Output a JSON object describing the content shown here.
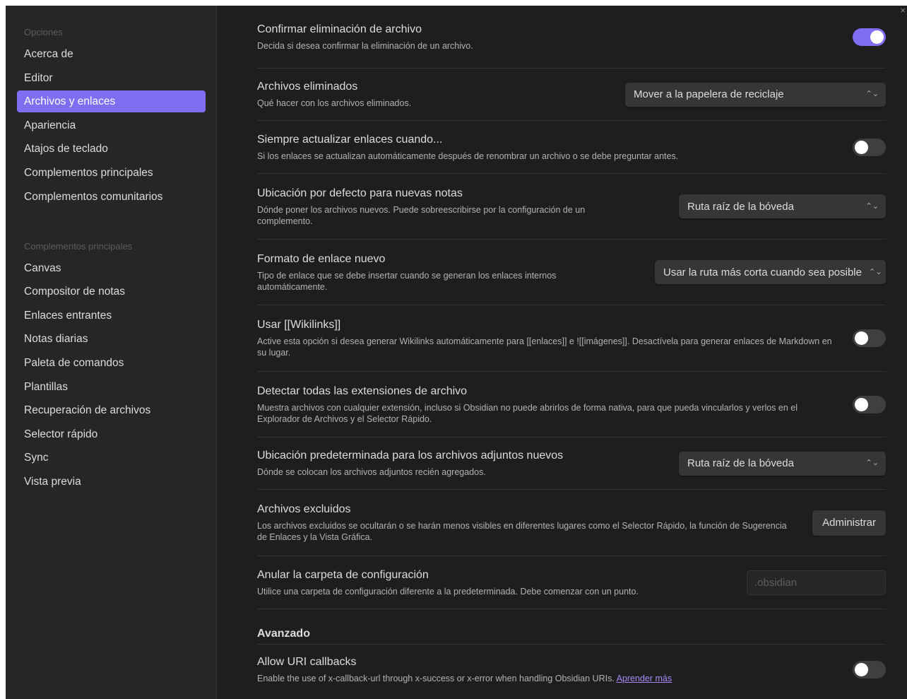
{
  "sidebar": {
    "heading_options": "Opciones",
    "options": [
      "Acerca de",
      "Editor",
      "Archivos y enlaces",
      "Apariencia",
      "Atajos de teclado",
      "Complementos principales",
      "Complementos comunitarios"
    ],
    "heading_plugins": "Complementos principales",
    "plugins": [
      "Canvas",
      "Compositor de notas",
      "Enlaces entrantes",
      "Notas diarias",
      "Paleta de comandos",
      "Plantillas",
      "Recuperación de archivos",
      "Selector rápido",
      "Sync",
      "Vista previa"
    ]
  },
  "settings": {
    "confirm_delete": {
      "name": "Confirmar eliminación de archivo",
      "desc": "Decida si desea confirmar la eliminación de un archivo.",
      "enabled": true
    },
    "deleted_files": {
      "name": "Archivos eliminados",
      "desc": "Qué hacer con los archivos eliminados.",
      "value": "Mover a la papelera de reciclaje"
    },
    "always_update_links": {
      "name": "Siempre actualizar enlaces cuando...",
      "desc": "Si los enlaces se actualizan automáticamente después de renombrar un archivo o se debe preguntar antes.",
      "enabled": false
    },
    "new_note_location": {
      "name": "Ubicación por defecto para nuevas notas",
      "desc": "Dónde poner los archivos nuevos. Puede sobreescribirse por la configuración de un complemento.",
      "value": "Ruta raíz de la bóveda"
    },
    "new_link_format": {
      "name": "Formato de enlace nuevo",
      "desc": "Tipo de enlace que se debe insertar cuando se generan los enlaces internos automáticamente.",
      "value": "Usar la ruta más corta cuando sea posible"
    },
    "wikilinks": {
      "name": "Usar [[Wikilinks]]",
      "desc": "Active esta opción si desea generar Wikilinks automáticamente para [[enlaces]] e ![[imágenes]]. Desactívela para generar enlaces de Markdown en su lugar.",
      "enabled": false
    },
    "detect_extensions": {
      "name": "Detectar todas las extensiones de archivo",
      "desc": "Muestra archivos con cualquier extensión, incluso si Obsidian no puede abrirlos de forma nativa, para que pueda vincularlos y verlos en el Explorador de Archivos y el Selector Rápido.",
      "enabled": false
    },
    "attachment_location": {
      "name": "Ubicación predeterminada para los archivos adjuntos nuevos",
      "desc": "Dónde se colocan los archivos adjuntos recién agregados.",
      "value": "Ruta raíz de la bóveda"
    },
    "excluded_files": {
      "name": "Archivos excluidos",
      "desc": "Los archivos excluidos se ocultarán o se harán menos visibles en diferentes lugares como el Selector Rápido, la función de Sugerencia de Enlaces y la Vista Gráfica.",
      "button": "Administrar"
    },
    "config_folder": {
      "name": "Anular la carpeta de configuración",
      "desc": "Utilice una carpeta de configuración diferente a la predeterminada. Debe comenzar con un punto.",
      "placeholder": ".obsidian",
      "value": ""
    },
    "advanced_heading": "Avanzado",
    "uri_callbacks": {
      "name": "Allow URI callbacks",
      "desc": "Enable the use of x-callback-url through x-success or x-error when handling Obsidian URIs.",
      "link": "Aprender más",
      "enabled": false
    }
  },
  "window": {
    "close_glyph": "×"
  },
  "colors": {
    "accent": "#7f6df2",
    "background": "#1e1e1e",
    "sidebar": "#262626",
    "link": "#a88bfa"
  }
}
